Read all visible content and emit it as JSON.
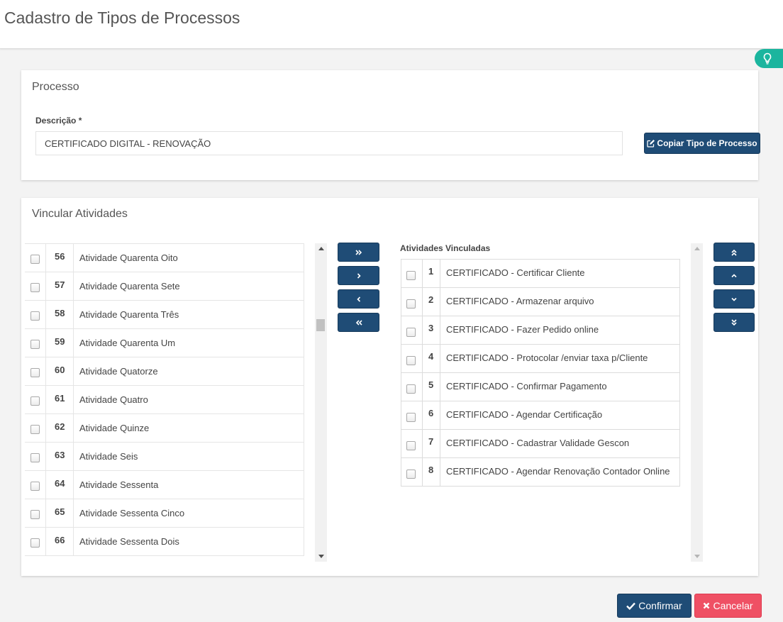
{
  "page": {
    "title": "Cadastro de Tipos de Processos"
  },
  "processo": {
    "title": "Processo",
    "descricao_label": "Descrição *",
    "descricao_value": "CERTIFICADO DIGITAL - RENOVAÇÃO",
    "copy_button": "Copiar Tipo de Processo"
  },
  "vincular": {
    "title": "Vincular Atividades",
    "linked_title": "Atividades Vinculadas",
    "available": [
      {
        "num": "56",
        "name": "Atividade Quarenta Oito"
      },
      {
        "num": "57",
        "name": "Atividade Quarenta Sete"
      },
      {
        "num": "58",
        "name": "Atividade Quarenta Três"
      },
      {
        "num": "59",
        "name": "Atividade Quarenta Um"
      },
      {
        "num": "60",
        "name": "Atividade Quatorze"
      },
      {
        "num": "61",
        "name": "Atividade Quatro"
      },
      {
        "num": "62",
        "name": "Atividade Quinze"
      },
      {
        "num": "63",
        "name": "Atividade Seis"
      },
      {
        "num": "64",
        "name": "Atividade Sessenta"
      },
      {
        "num": "65",
        "name": "Atividade Sessenta Cinco"
      },
      {
        "num": "66",
        "name": "Atividade Sessenta Dois"
      }
    ],
    "linked": [
      {
        "num": "1",
        "name": "CERTIFICADO - Certificar Cliente"
      },
      {
        "num": "2",
        "name": "CERTIFICADO - Armazenar arquivo"
      },
      {
        "num": "3",
        "name": "CERTIFICADO - Fazer Pedido online"
      },
      {
        "num": "4",
        "name": "CERTIFICADO - Protocolar /enviar taxa p/Cliente"
      },
      {
        "num": "5",
        "name": "CERTIFICADO - Confirmar Pagamento"
      },
      {
        "num": "6",
        "name": "CERTIFICADO - Agendar Certificação"
      },
      {
        "num": "7",
        "name": "CERTIFICADO - Cadastrar Validade Gescon"
      },
      {
        "num": "8",
        "name": "CERTIFICADO - Agendar Renovação Contador Online"
      }
    ]
  },
  "footer": {
    "confirm": "Confirmar",
    "cancel": "Cancelar"
  },
  "colors": {
    "primary": "#1f4c76",
    "danger": "#ef5064",
    "hint": "#1bb59e",
    "background": "#f3f3f3"
  }
}
